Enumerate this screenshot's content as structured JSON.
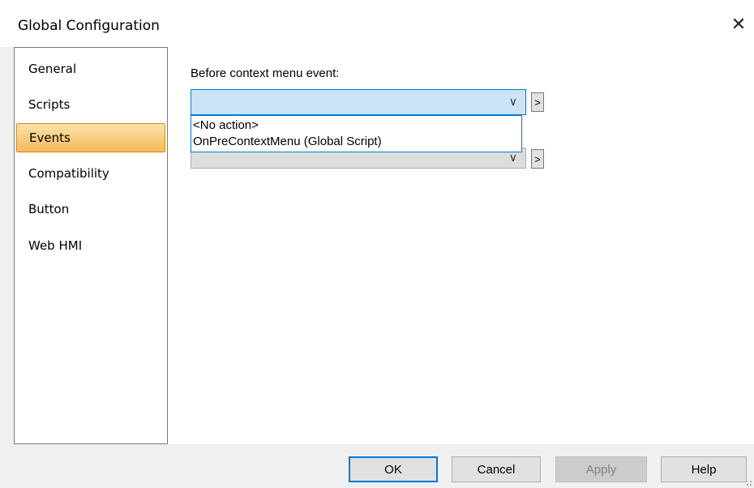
{
  "window": {
    "title": "Global Configuration",
    "close_glyph": "✕"
  },
  "sidebar": {
    "items": [
      {
        "label": "General",
        "selected": false
      },
      {
        "label": "Scripts",
        "selected": false
      },
      {
        "label": "Events",
        "selected": true
      },
      {
        "label": "Compatibility",
        "selected": false
      },
      {
        "label": "Button",
        "selected": false
      },
      {
        "label": "Web HMI",
        "selected": false
      }
    ]
  },
  "main": {
    "event_label": "Before context menu event:",
    "combo_value": "",
    "chevron": "∨",
    "arrow_button": ">",
    "dropdown_options": [
      "<No action>",
      "OnPreContextMenu (Global Script)"
    ]
  },
  "footer": {
    "ok_label": "OK",
    "cancel_label": "Cancel",
    "apply_label": "Apply",
    "help_label": "Help"
  },
  "colors": {
    "selection_gradient_top": "#fbe3a8",
    "selection_gradient_bottom": "#f5b95a",
    "focus_blue": "#0078d7"
  }
}
